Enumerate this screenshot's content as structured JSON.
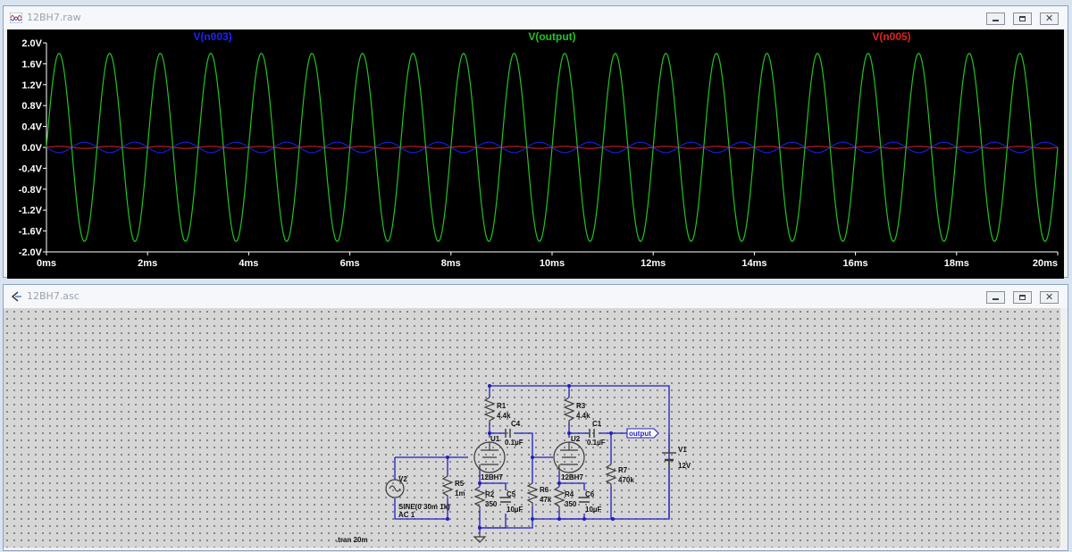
{
  "waveform_window": {
    "title": "12BH7.raw"
  },
  "schematic_window": {
    "title": "12BH7.asc",
    "directive": ".tran 20m",
    "components": {
      "r1_name": "R1",
      "r1_value": "4.4k",
      "r3_name": "R3",
      "r3_value": "4.4k",
      "c4_name": "C4",
      "c4_value": "0.1µF",
      "c1_name": "C1",
      "c1_value": "0.1µF",
      "u1_name": "U1",
      "u1_model": "12BH7",
      "u2_name": "U2",
      "u2_model": "12BH7",
      "r2_name": "R2",
      "r2_value": "350",
      "c5_name": "C5",
      "c5_value": "10µF",
      "r4_name": "R4",
      "r4_value": "350",
      "c6_name": "C6",
      "c6_value": "10µF",
      "r5_name": "R5",
      "r5_value": "1m",
      "r6_name": "R6",
      "r6_value": "47k",
      "r7_name": "R7",
      "r7_value": "470k",
      "v1_name": "V1",
      "v1_value": "12V",
      "v2_name": "V2",
      "v2_func": "SINE(0 30m 1k)",
      "v2_ac": "AC 1",
      "output_label": "output"
    }
  },
  "colors": {
    "n003": "#2020ff",
    "output": "#22c322",
    "n005": "#e02020",
    "axis": "#ffffff",
    "wire": "#1f1fbf",
    "component": "#3a3a3a"
  },
  "chart_data": {
    "type": "line",
    "xlabel": "",
    "ylabel": "",
    "x_ticks": [
      "0ms",
      "2ms",
      "4ms",
      "6ms",
      "8ms",
      "10ms",
      "12ms",
      "14ms",
      "16ms",
      "18ms",
      "20ms"
    ],
    "y_ticks": [
      "2.0V",
      "1.6V",
      "1.2V",
      "0.8V",
      "0.4V",
      "0.0V",
      "-0.4V",
      "-0.8V",
      "-1.2V",
      "-1.6V",
      "-2.0V"
    ],
    "xlim": [
      0,
      20
    ],
    "ylim": [
      -2.0,
      2.0
    ],
    "series": [
      {
        "name": "V(n003)",
        "frequency_khz": 1,
        "amplitude": 0.1,
        "phase": "inverted",
        "color_key": "n003"
      },
      {
        "name": "V(output)",
        "frequency_khz": 1,
        "amplitude": 1.8,
        "phase": "normal",
        "color_key": "output"
      },
      {
        "name": "V(n005)",
        "frequency_khz": 1,
        "amplitude": 0.02,
        "phase": "normal",
        "color_key": "n005"
      }
    ]
  }
}
